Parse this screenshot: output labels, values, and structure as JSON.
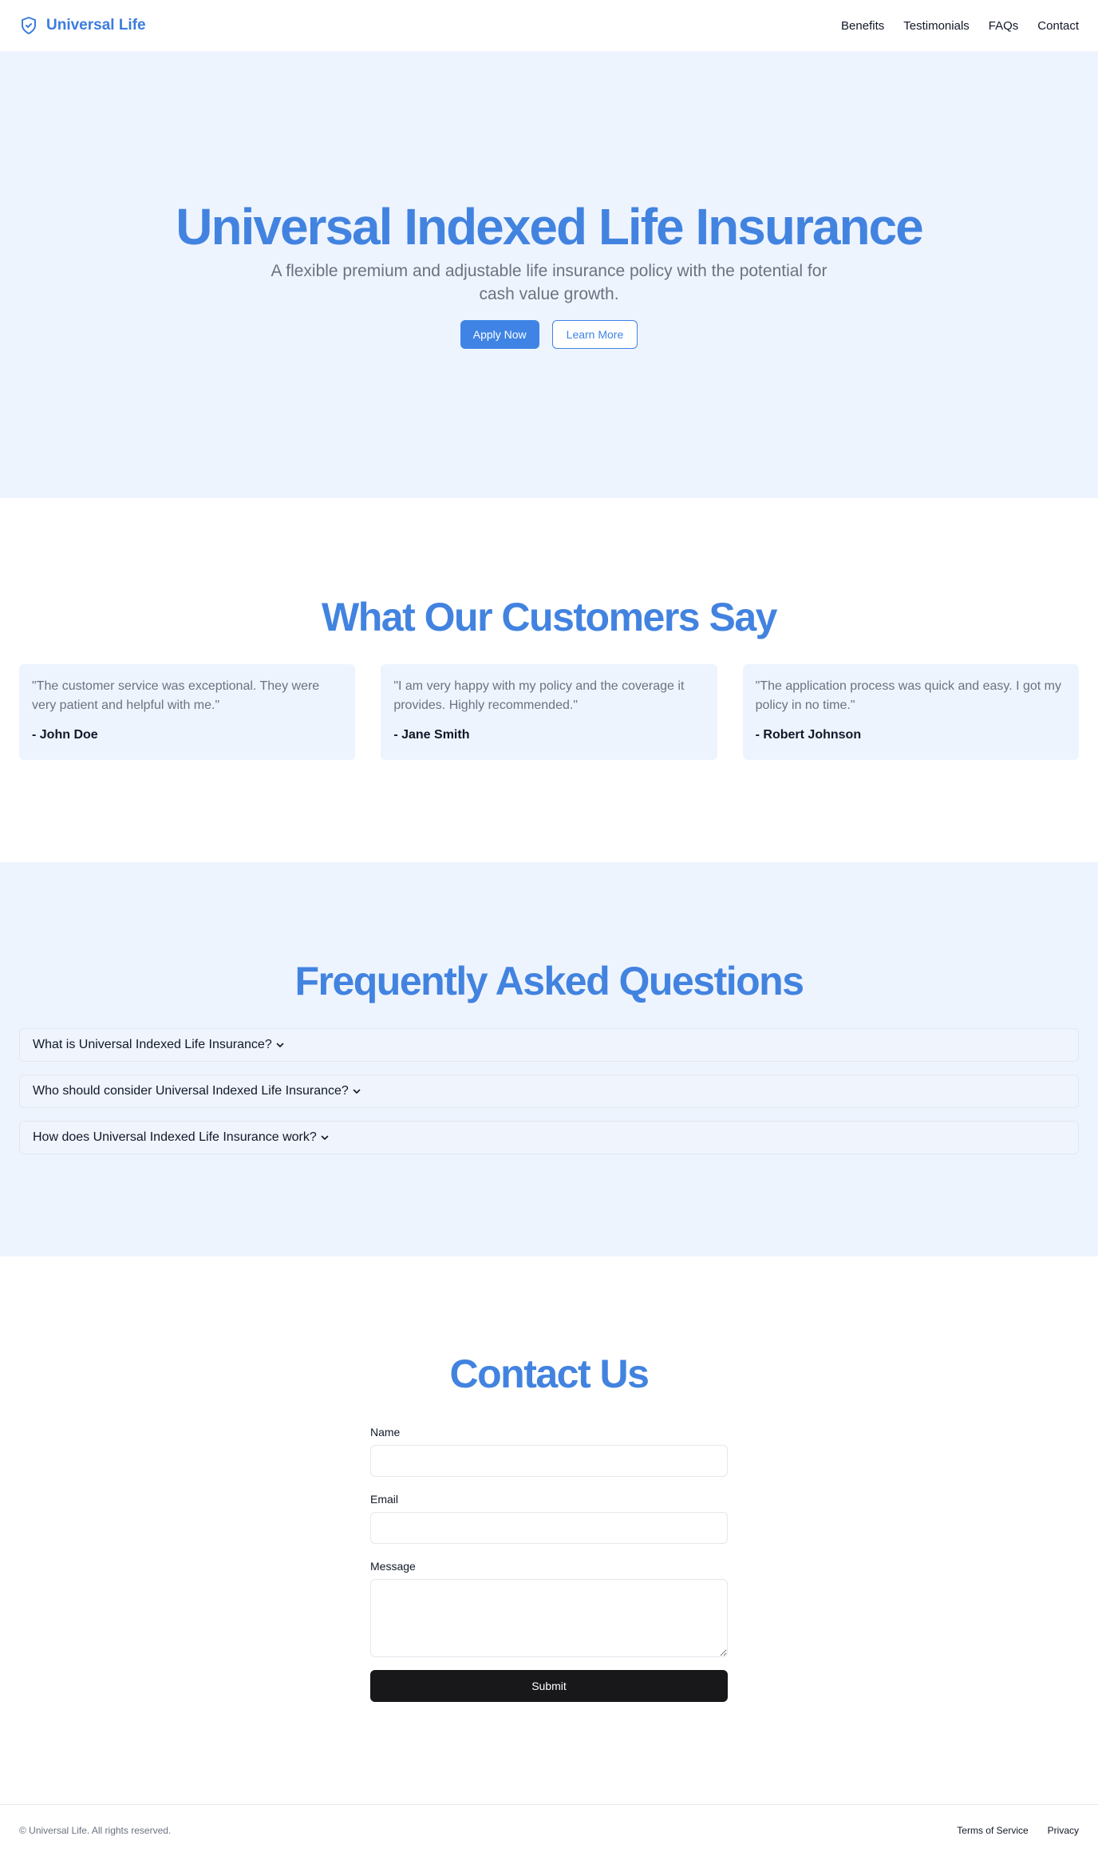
{
  "colors": {
    "accent": "#4283e0",
    "hero_bg": "#eef4fe",
    "submit_bg": "#18181b"
  },
  "header": {
    "logo_icon": "shield-check-icon",
    "brand": "Universal Life",
    "nav": [
      "Benefits",
      "Testimonials",
      "FAQs",
      "Contact"
    ]
  },
  "hero": {
    "title": "Universal Indexed Life Insurance",
    "subtitle": "A flexible premium and adjustable life insurance policy with the potential for cash value growth.",
    "apply_label": "Apply Now",
    "learn_label": "Learn More"
  },
  "testimonials": {
    "title": "What Our Customers Say",
    "items": [
      {
        "quote": "\"The customer service was exceptional. They were very patient and helpful with me.\"",
        "author": "- John Doe"
      },
      {
        "quote": "\"I am very happy with my policy and the coverage it provides. Highly recommended.\"",
        "author": "- Jane Smith"
      },
      {
        "quote": "\"The application process was quick and easy. I got my policy in no time.\"",
        "author": "- Robert Johnson"
      }
    ]
  },
  "faq": {
    "title": "Frequently Asked Questions",
    "chevron_icon": "chevron-down-icon",
    "items": [
      "What is Universal Indexed Life Insurance?",
      "Who should consider Universal Indexed Life Insurance?",
      "How does Universal Indexed Life Insurance work?"
    ]
  },
  "contact": {
    "title": "Contact Us",
    "name_label": "Name",
    "name_value": "",
    "email_label": "Email",
    "email_value": "",
    "message_label": "Message",
    "message_value": "",
    "submit_label": "Submit"
  },
  "footer": {
    "copyright": "© Universal Life. All rights reserved.",
    "links": [
      "Terms of Service",
      "Privacy"
    ]
  }
}
